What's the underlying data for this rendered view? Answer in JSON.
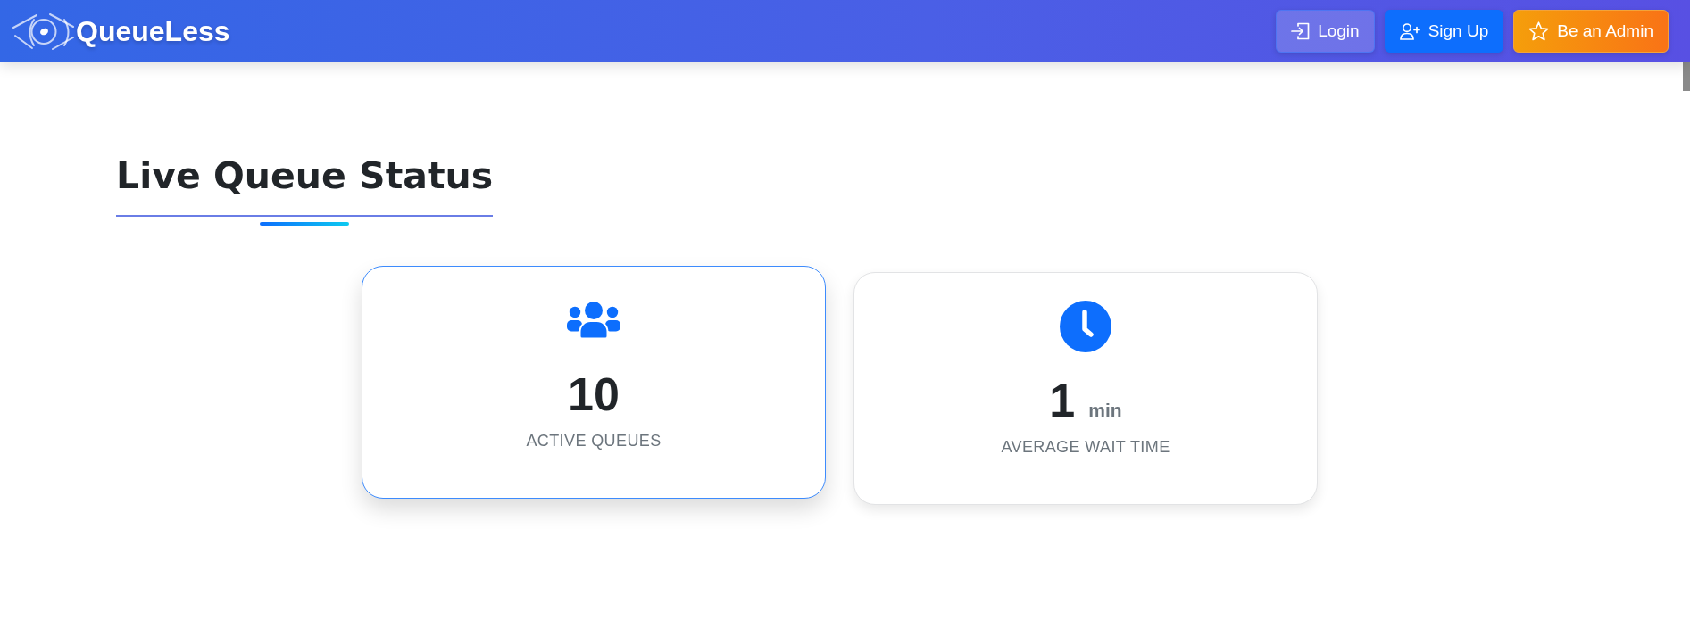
{
  "header": {
    "brand": "QueueLess",
    "buttons": [
      {
        "kind": "login",
        "label": "Login"
      },
      {
        "kind": "signup",
        "label": "Sign Up"
      },
      {
        "kind": "admin",
        "label": "Be an Admin"
      }
    ]
  },
  "section": {
    "title": "Live Queue Status"
  },
  "stats": [
    {
      "kind": "people",
      "value": "10",
      "label": "ACTIVE QUEUES",
      "hovered": true
    },
    {
      "kind": "clock",
      "value": "1",
      "unit": "min",
      "label": "AVERAGE WAIT TIME",
      "hovered": false
    }
  ]
}
